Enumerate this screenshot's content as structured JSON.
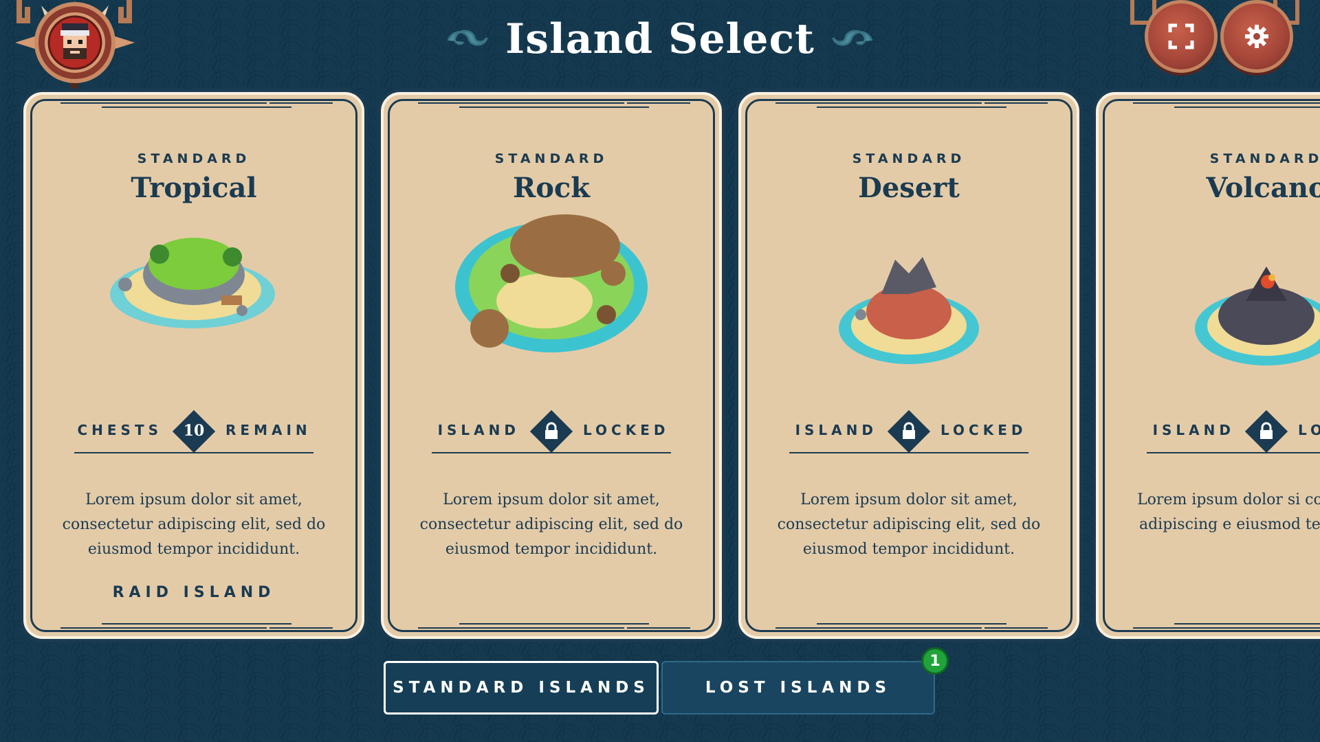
{
  "header": {
    "title": "Island Select"
  },
  "cards": [
    {
      "category": "STANDARD",
      "name": "Tropical",
      "stat_left": "CHESTS",
      "stat_value": "10",
      "stat_right": "REMAIN",
      "description": "Lorem ipsum dolor sit amet, consectetur adipiscing elit, sed do eiusmod tempor incididunt.",
      "action": "RAID ISLAND"
    },
    {
      "category": "STANDARD",
      "name": "Rock",
      "stat_left": "ISLAND",
      "stat_value": "",
      "stat_right": "LOCKED",
      "description": "Lorem ipsum dolor sit amet, consectetur adipiscing elit, sed do eiusmod tempor incididunt."
    },
    {
      "category": "STANDARD",
      "name": "Desert",
      "stat_left": "ISLAND",
      "stat_value": "",
      "stat_right": "LOCKED",
      "description": "Lorem ipsum dolor sit amet, consectetur adipiscing elit, sed do eiusmod tempor incididunt."
    },
    {
      "category": "STANDARD",
      "name": "Volcano",
      "stat_left": "ISLAND",
      "stat_value": "",
      "stat_right": "LO",
      "description": "Lorem ipsum dolor si consectetur adipiscing e eiusmod tempor inci"
    }
  ],
  "tabs": {
    "standard": "STANDARD ISLANDS",
    "lost": "LOST ISLANDS",
    "lost_badge": "1"
  },
  "icons": {
    "avatar": "pirate-avatar",
    "fullscreen": "fullscreen-icon",
    "settings": "gear-icon",
    "lock": "lock-icon"
  },
  "colors": {
    "background": "#153a50",
    "card": "#e4cba8",
    "ink": "#1a3b51",
    "button": "#a6473a",
    "badge": "#1fa33a"
  }
}
